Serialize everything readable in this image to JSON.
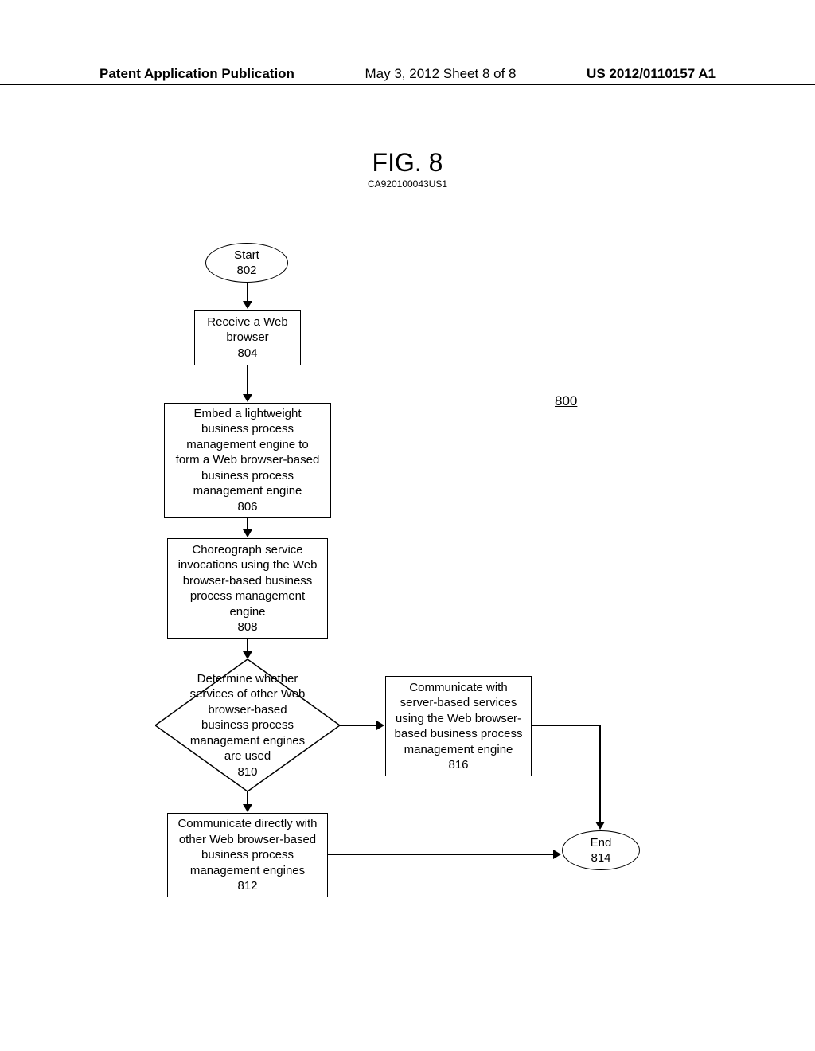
{
  "header": {
    "left": "Patent Application Publication",
    "center": "May 3, 2012  Sheet 8 of 8",
    "right": "US 2012/0110157 A1"
  },
  "figure": {
    "title": "FIG. 8",
    "subtitle": "CA920100043US1"
  },
  "diagram_ref": "800",
  "nodes": {
    "start": {
      "line1": "Start",
      "line2": "802"
    },
    "receive": {
      "line1": "Receive a Web",
      "line2": "browser",
      "line3": "804"
    },
    "embed": {
      "line1": "Embed a lightweight",
      "line2": "business process",
      "line3": "management engine to",
      "line4": "form a Web browser-based",
      "line5": "business process",
      "line6": "management engine",
      "line7": "806"
    },
    "choreograph": {
      "line1": "Choreograph service",
      "line2": "invocations using the Web",
      "line3": "browser-based business",
      "line4": "process management",
      "line5": "engine",
      "line6": "808"
    },
    "determine": {
      "line1": "Determine whether",
      "line2": "services of other  Web",
      "line3": "browser-based",
      "line4": "business process",
      "line5": "management engines",
      "line6": "are used",
      "line7": "810"
    },
    "communicate_server": {
      "line1": "Communicate with",
      "line2": "server-based services",
      "line3": "using the Web browser-",
      "line4": "based business process",
      "line5": "management engine",
      "line6": "816"
    },
    "communicate_direct": {
      "line1": "Communicate directly with",
      "line2": "other Web browser-based",
      "line3": "business process",
      "line4": "management engines",
      "line5": "812"
    },
    "end": {
      "line1": "End",
      "line2": "814"
    }
  }
}
